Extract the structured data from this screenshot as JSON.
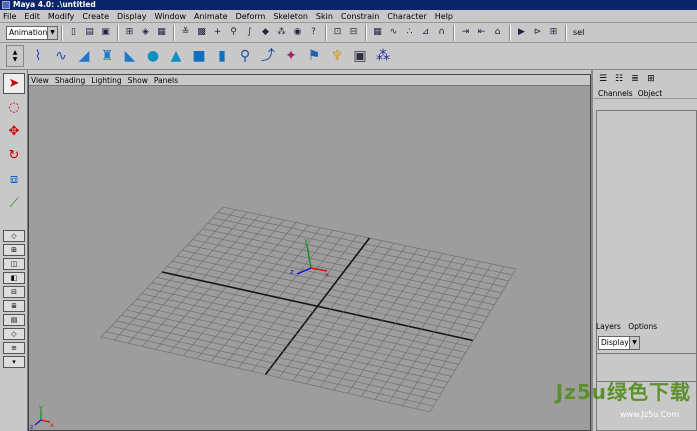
{
  "window": {
    "title": "Maya 4.0: .\\untitled"
  },
  "menubar": {
    "items": [
      "File",
      "Edit",
      "Modify",
      "Create",
      "Display",
      "Window",
      "Animate",
      "Deform",
      "Skeleton",
      "Skin",
      "Constrain",
      "Character",
      "Help"
    ]
  },
  "statusline": {
    "mode": "Animation",
    "sel_label": "sel"
  },
  "viewport": {
    "panel_menu": [
      "View",
      "Shading",
      "Lighting",
      "Show",
      "Panels"
    ],
    "axis_labels": {
      "x": "x",
      "y": "y",
      "z": "z"
    }
  },
  "sidebar": {
    "tabs": [
      "Channels",
      "Object"
    ],
    "layers_menu": [
      "Layers",
      "Options"
    ],
    "layer_mode": "Display"
  },
  "watermark": {
    "main": "Jz5u绿色下载",
    "sub": "www.Jz5u.Com"
  },
  "colors": {
    "viewport_bg": "#9d9d9d",
    "grid_line": "#6a6a6a",
    "grid_axis": "#141414",
    "axis_x": "#cc1111",
    "axis_y": "#1a8a1a",
    "axis_z": "#1111cc",
    "title_bg": "#0a246a"
  }
}
